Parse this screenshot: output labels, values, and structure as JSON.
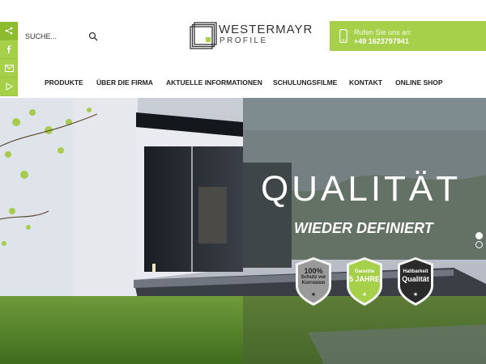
{
  "search": {
    "placeholder": "SUCHE..."
  },
  "logo": {
    "name": "WESTERMAYR",
    "sub": "PROFILE"
  },
  "contact": {
    "lead": "Rufen Sie uns an:",
    "phone": "+49 1623797941"
  },
  "nav": [
    {
      "label": "PRODUKTE"
    },
    {
      "label": "ÜBER DIE FIRMA"
    },
    {
      "label": "AKTUELLE INFORMATIONEN"
    },
    {
      "label": "SCHULUNGSFILME"
    },
    {
      "label": "KONTAKT"
    },
    {
      "label": "ONLINE SHOP"
    }
  ],
  "social": [
    "share-icon",
    "facebook-icon",
    "mail-icon",
    "play-icon"
  ],
  "hero": {
    "title": "QUALITÄT",
    "subtitle": "WIEDER DEFINIERT",
    "badges": [
      {
        "line1": "100%",
        "line2": "Schutz vor",
        "line3": "Korrosion",
        "color": "#9a9a9a"
      },
      {
        "line1": "Garantie",
        "line2": "5 JAHRE",
        "line3": "",
        "color": "#a6cf4a"
      },
      {
        "line1": "Haltbarkeit",
        "line2": "Qualität",
        "line3": "",
        "color": "#2a2a2a"
      }
    ],
    "slides": 2,
    "active_slide": 1
  },
  "colors": {
    "accent": "#a6cf4a",
    "accent_dark": "#8dbb2f",
    "text": "#222222"
  }
}
